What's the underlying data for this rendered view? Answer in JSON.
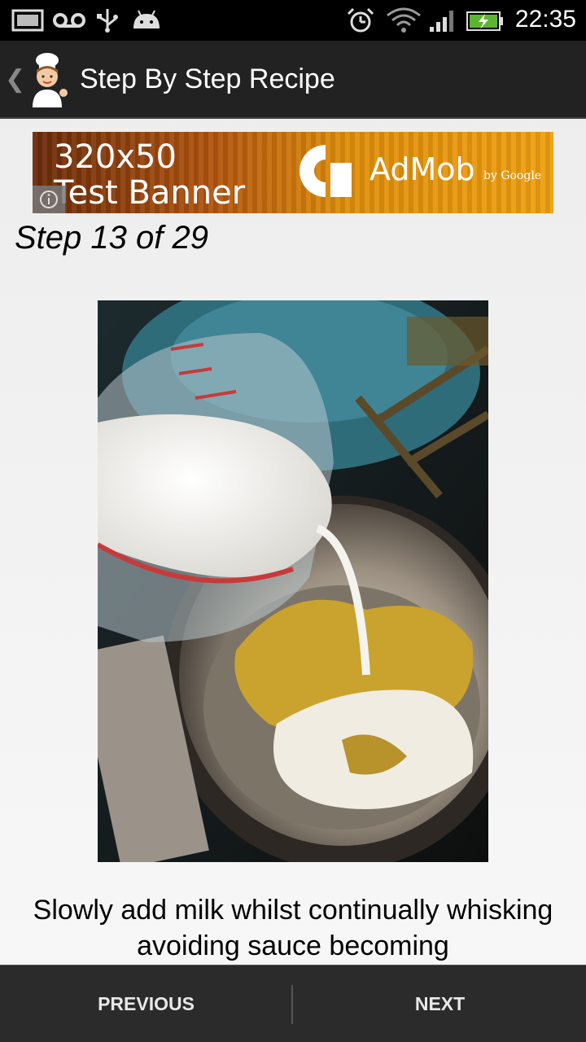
{
  "status_bar": {
    "time": "22:35",
    "icons": [
      "screenshot-icon",
      "voicemail-icon",
      "usb-icon",
      "android-debug-icon",
      "alarm-icon",
      "wifi-icon",
      "signal-icon",
      "battery-charging-icon"
    ]
  },
  "action_bar": {
    "title": "Step By Step Recipe",
    "up_icon": "chevron-left-icon",
    "app_icon": "chef-icon"
  },
  "ad": {
    "line1": "320x50",
    "line2": "Test Banner",
    "brand": "AdMob",
    "by": "by Google"
  },
  "step": {
    "label": "Step 13 of 29"
  },
  "description": "Slowly add milk whilst continually whisking avoiding sauce becoming",
  "nav": {
    "previous": "PREVIOUS",
    "next": "NEXT"
  },
  "colors": {
    "status_bar_bg": "#000000",
    "action_bar_bg": "#222222",
    "bottom_bar_bg": "#2b2b2b",
    "ad_accent": "#e08e0b"
  }
}
